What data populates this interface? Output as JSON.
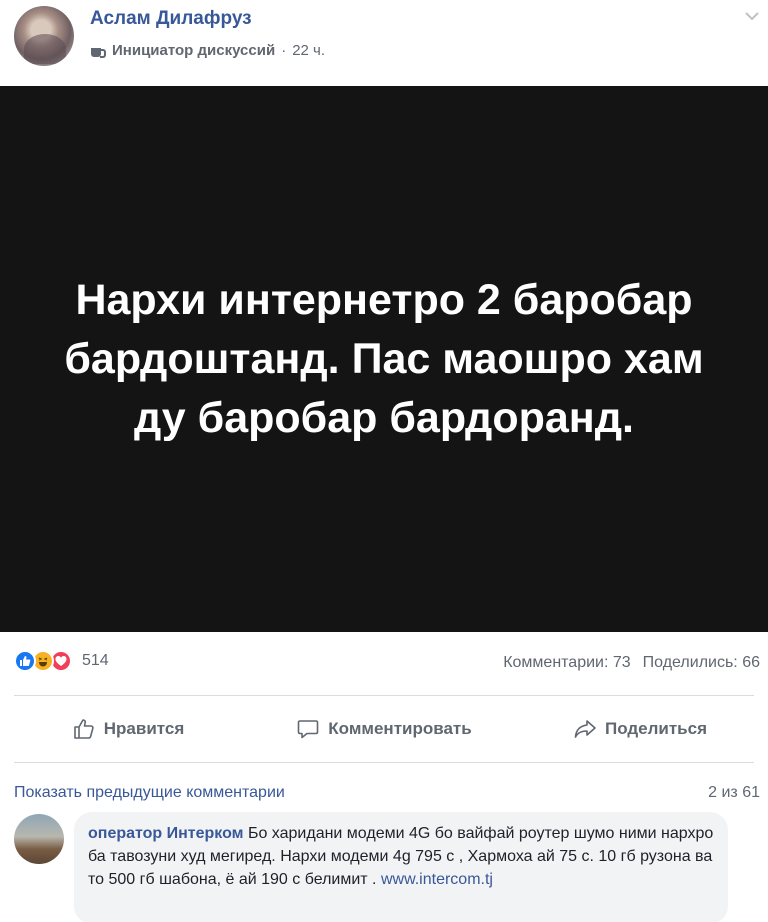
{
  "post": {
    "author": "Аслам Дилафруз",
    "badge_label": "Инициатор дискуссий",
    "separator": "·",
    "time": "22 ч.",
    "image_text": "Нархи интернетро 2 баробар бардоштанд. Пас маошро хам ду баробар бардоранд."
  },
  "stats": {
    "reaction_icons": [
      "like-icon",
      "haha-icon",
      "love-icon"
    ],
    "reaction_count": "514",
    "comments": "Комментарии: 73",
    "shares": "Поделились: 66"
  },
  "actions": {
    "like": "Нравится",
    "comment": "Комментировать",
    "share": "Поделиться"
  },
  "comments_section": {
    "show_previous": "Показать предыдущие комментарии",
    "pager": "2 из 61",
    "comment": {
      "author": "оператор Интерком",
      "text": "Бо харидани модеми 4G бо вайфай роутер шумо ними нархро ба тавозуни худ мегиред. Нархи модеми 4g 795 с , Хармоха ай 75 с. 10 гб рузона ва то 500 гб шабона, ё ай 190 с белимит .",
      "link": "www.intercom.tj"
    }
  },
  "colors": {
    "link_blue": "#385898",
    "image_background": "#141414",
    "like_blue": "#1877f2",
    "haha_yellow": "#f7b125",
    "love_red": "#f33e58"
  }
}
